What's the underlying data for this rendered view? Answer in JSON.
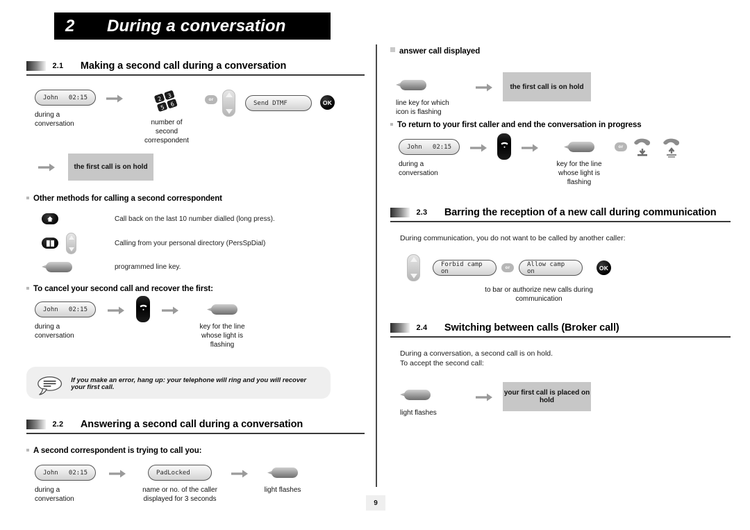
{
  "chapter": {
    "number": "2",
    "title": "During a conversation"
  },
  "page_number": "9",
  "colors": {
    "banner_bg": "#000000",
    "grey_box": "#c7c7c7",
    "note_bg": "#efefef",
    "rule": "#3a3a3a"
  },
  "sections": {
    "s21": {
      "number": "2.1",
      "title": "Making a second call during a conversation",
      "step_row": {
        "lcd_name": "John",
        "lcd_time": "02:15",
        "caption_lcd": "during a\nconversation",
        "keypad_icon": "keypad-icon",
        "caption_keypad": "number of\nsecond\ncorrespondent",
        "or_label": "or",
        "nav_icon": "nav-updown-icon",
        "softkey_label": "Send DTMF",
        "ok_label": "OK"
      },
      "result": {
        "arrow": "arrow-right-icon",
        "message": "the first call is on hold"
      },
      "other_methods": {
        "heading": "Other methods for calling a second correspondent",
        "items": [
          {
            "icons": [
              "redial-key-icon"
            ],
            "text": "Call back on the last 10 number dialled (long press)."
          },
          {
            "icons": [
              "directory-key-icon",
              "nav-updown-icon"
            ],
            "text": "Calling from your personal directory (PersSpDial)"
          },
          {
            "icons": [
              "line-key-icon"
            ],
            "text": "programmed line key."
          }
        ]
      },
      "cancel": {
        "heading": "To cancel your second call and recover the first:",
        "lcd_name": "John",
        "lcd_time": "02:15",
        "caption_lcd": "during a\nconversation",
        "hangup_icon": "hangup-key-icon",
        "line_key_icon": "line-key-icon",
        "caption_linekey": "key for the line\nwhose light is\nflashing"
      },
      "note": {
        "icon": "speech-bubble-icon",
        "text": "If you make an error, hang up: your telephone will ring and you will recover your first call."
      }
    },
    "s22": {
      "number": "2.2",
      "title": "Answering a second call during a conversation",
      "sub_heading": "A second correspondent is trying to call you:",
      "step_row": {
        "lcd_name": "John",
        "lcd_time": "02:15",
        "caption_lcd": "during a\nconversation",
        "lcd_caller": "PadLocked",
        "caption_caller": "name or no. of the caller\ndisplayed for 3 seconds",
        "line_key_icon": "line-key-icon",
        "caption_linekey": "light flashes"
      },
      "answer": {
        "sub_heading": "answer call displayed",
        "line_key_icon": "line-key-icon",
        "caption_linekey": "line key for which\nicon is flashing",
        "message": "the first call is on hold"
      },
      "return": {
        "heading": "To return to your first caller and end the conversation in progress",
        "lcd_name": "John",
        "lcd_time": "02:15",
        "caption_lcd": "during a\nconversation",
        "hangup_icon": "hangup-key-icon",
        "line_key_icon": "line-key-icon",
        "caption_linekey": "key for the line\nwhose light is\nflashing",
        "or_label": "or",
        "handset_down_icon": "handset-down-icon",
        "handset_up_icon": "handset-up-icon"
      }
    },
    "s23": {
      "number": "2.3",
      "title": "Barring the reception of a new call during communication",
      "intro": "During communication, you do not want to be called by another caller:",
      "step_row": {
        "nav_icon": "nav-updown-icon",
        "softkey_forbid": "Forbid camp on",
        "or_label": "or",
        "softkey_allow": "Allow camp on",
        "ok_label": "OK",
        "caption": "to bar or authorize new calls during\ncommunication"
      }
    },
    "s24": {
      "number": "2.4",
      "title": "Switching between calls (Broker call)",
      "intro_line1": "During a conversation, a second call is on hold.",
      "intro_line2": "To accept the second call:",
      "step_row": {
        "line_key_icon": "line-key-icon",
        "caption_linekey": "light flashes",
        "arrow": "arrow-right-icon",
        "message": "your first call is placed on hold"
      }
    }
  }
}
